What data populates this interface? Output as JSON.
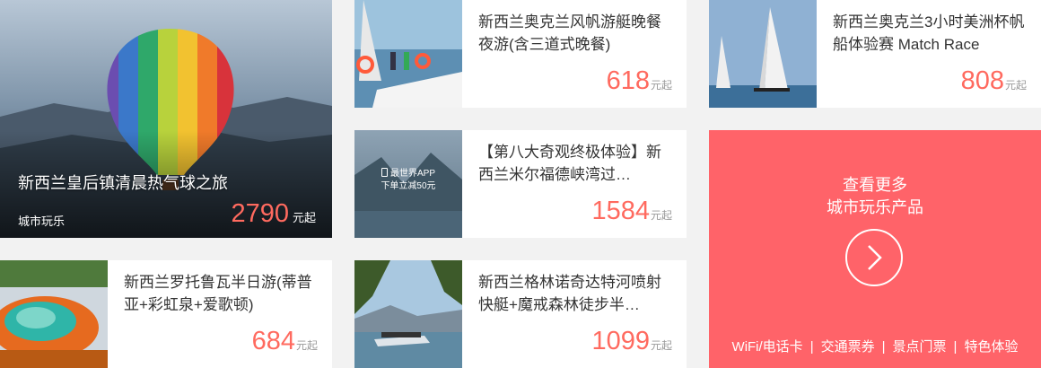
{
  "hero": {
    "title": "新西兰皇后镇清晨热气球之旅",
    "category": "城市玩乐",
    "price": "2790",
    "price_unit": "元起"
  },
  "cards": [
    {
      "title": "新西兰奥克兰风帆游艇晚餐夜游(含三道式晚餐)",
      "price": "618",
      "unit": "元起"
    },
    {
      "title": "新西兰奥克兰3小时美洲杯帆船体验赛 Match Race",
      "price": "808",
      "unit": "元起"
    },
    {
      "title": "【第八大奇观终极体验】新西兰米尔福德峡湾过…",
      "price": "1584",
      "unit": "元起",
      "badge_line1": "最世界APP",
      "badge_line2": "下单立减50元"
    },
    {
      "title": "新西兰罗托鲁瓦半日游(蒂普亚+彩虹泉+爱歌顿)",
      "price": "684",
      "unit": "元起"
    },
    {
      "title": "新西兰格林诺奇达特河喷射快艇+魔戒森林徒步半…",
      "price": "1099",
      "unit": "元起"
    }
  ],
  "more": {
    "line1": "查看更多",
    "line2": "城市玩乐产品",
    "links": [
      "WiFi/电话卡",
      "交通票券",
      "景点门票",
      "特色体验"
    ],
    "separator": "|"
  },
  "colors": {
    "accent": "#ff6369",
    "price": "#ff6a5f"
  }
}
